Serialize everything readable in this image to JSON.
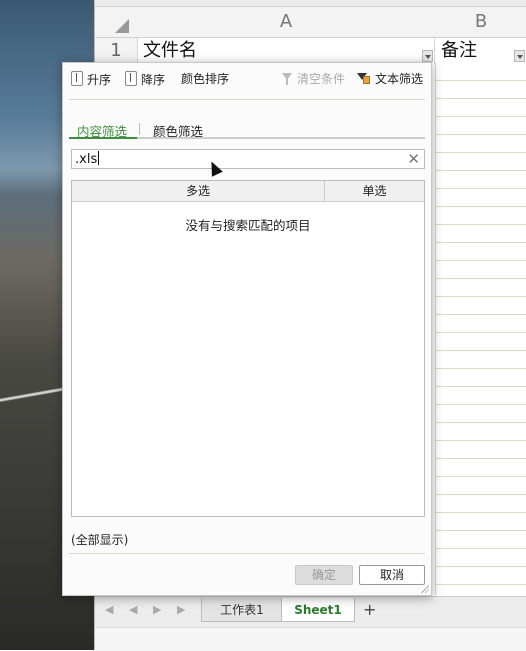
{
  "spreadsheet": {
    "columns": [
      "A",
      "B"
    ],
    "rows": [
      {
        "num": "1",
        "cells": [
          "文件名",
          "备注"
        ]
      }
    ],
    "sheet_tabs": [
      {
        "label": "工作表1",
        "active": false
      },
      {
        "label": "Sheet1",
        "active": true
      }
    ],
    "add_sheet": "+"
  },
  "filter": {
    "toolbar": {
      "ascending": "升序",
      "descending": "降序",
      "color_sort": "颜色排序",
      "clear_conditions": "清空条件",
      "text_filter": "文本筛选"
    },
    "tabs": [
      {
        "label": "内容筛选",
        "active": true
      },
      {
        "label": "颜色筛选",
        "active": false
      }
    ],
    "search": {
      "value": ".xls",
      "clear_icon": "✕"
    },
    "list_headers": {
      "multi": "多选",
      "single": "单选"
    },
    "empty_message": "没有与搜索匹配的项目",
    "show_all": "(全部显示)",
    "buttons": {
      "ok": "确定",
      "cancel": "取消"
    }
  },
  "colors": {
    "accent": "#3d8f3d",
    "active_tab": "#2d7a2d"
  }
}
